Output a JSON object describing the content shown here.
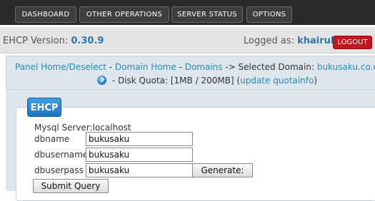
{
  "nav": {
    "items": [
      {
        "label": "DASHBOARD"
      },
      {
        "label": "OTHER OPERATIONS"
      },
      {
        "label": "SERVER STATUS"
      },
      {
        "label": "OPTIONS"
      }
    ]
  },
  "status": {
    "version_label": "EHCP Version:",
    "version": "0.30.9",
    "logged_label": "Logged as:",
    "user": "khairul",
    "logout": "LOGOUT"
  },
  "breadcrumb": {
    "panel_home": "Panel Home/Deselect",
    "sep1": " - ",
    "domain_home": "Domain Home",
    "sep2": " - ",
    "domains": "Domains",
    "selected_label": " -> Selected Domain: ",
    "selected_domain": "bukusaku.co.cc",
    "quota_text": " - Disk Quota: [1MB / 200MB] (",
    "update_quota": "update quotainfo",
    "quota_close": ")"
  },
  "panel": {
    "title": "EHCP",
    "mysql_server": "Mysql Server:localhost",
    "fields": [
      {
        "label": "dbname",
        "value": "bukusaku"
      },
      {
        "label": "dbusername",
        "value": "bukusaku"
      },
      {
        "label": "dbuserpass",
        "value": "bukusaku"
      }
    ],
    "generate": "Generate:",
    "submit": "Submit Query"
  }
}
